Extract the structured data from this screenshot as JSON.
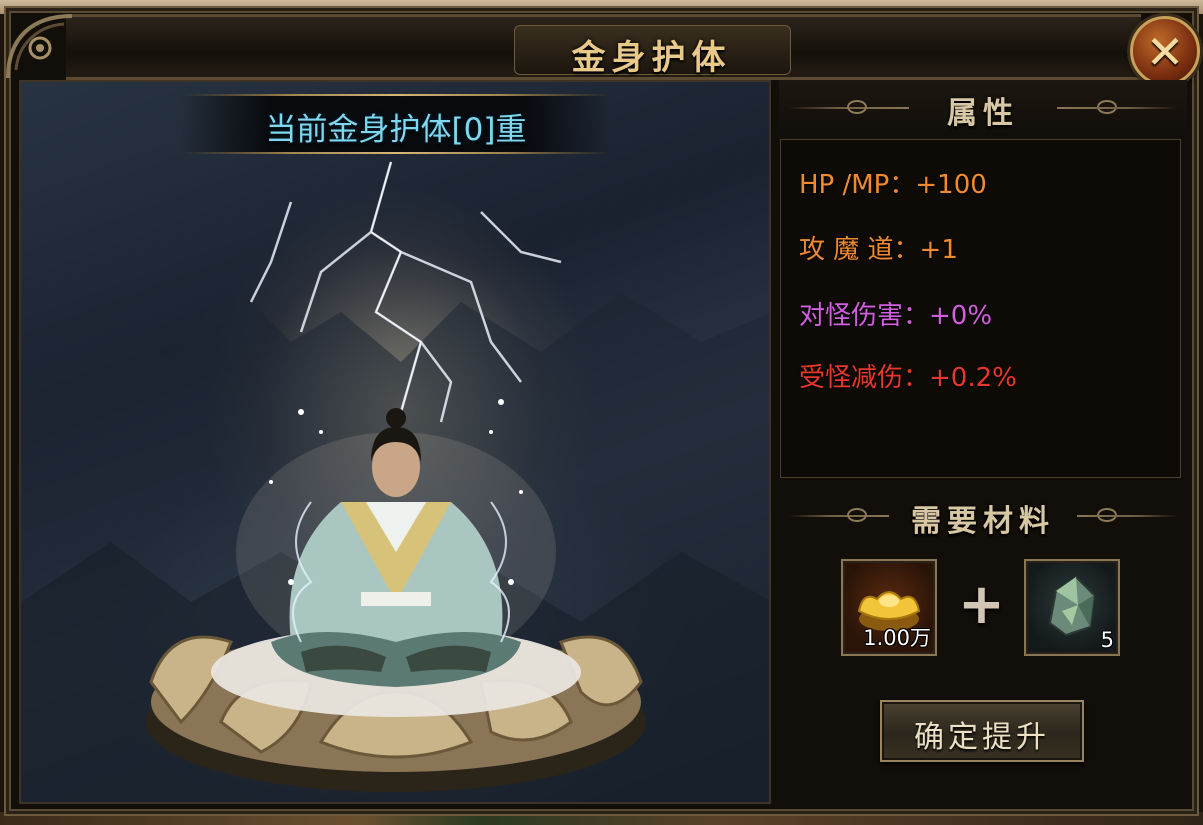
{
  "window": {
    "title": "金身护体",
    "close_icon": "close-x-icon"
  },
  "scene": {
    "banner_text": "当前金身护体[0]重"
  },
  "attributes": {
    "title": "属性",
    "rows": [
      {
        "text": "HP /MP：+100",
        "color": "#f08a2c"
      },
      {
        "text": "攻 魔 道：+1",
        "color": "#f08a2c"
      },
      {
        "text": "对怪伤害：+0%",
        "color": "#d25ee0"
      },
      {
        "text": "受怪减伤：+0.2%",
        "color": "#e8362a"
      }
    ]
  },
  "materials": {
    "title": "需要材料",
    "items": [
      {
        "icon": "gold-ingot-icon",
        "count": "1.00万"
      },
      {
        "icon": "jade-stone-icon",
        "count": "5"
      }
    ],
    "plus_symbol": "+"
  },
  "confirm_button": {
    "label": "确定提升"
  }
}
